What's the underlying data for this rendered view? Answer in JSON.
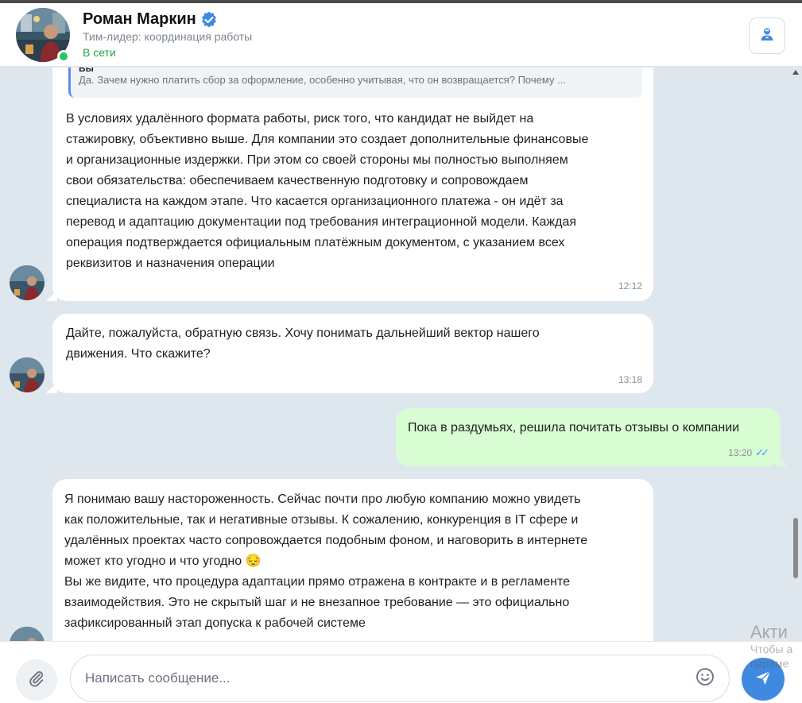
{
  "header": {
    "name": "Роман Маркин",
    "role": "Тим-лидер: координация работы",
    "status": "В сети"
  },
  "quote": {
    "author": "Вы",
    "text": "Да. Зачем нужно платить сбор за оформление, особенно учитывая, что он возвращается? Почему ..."
  },
  "messages": [
    {
      "direction": "in",
      "lines": [
        "В условиях удалённого формата работы, риск того, что кандидат не выйдет на",
        "стажировку, объективно выше. Для компании это создает дополнительные финансовые",
        "и организационные издержки. При этом со своей стороны мы полностью выполняем",
        "свои обязательства: обеспечиваем качественную подготовку и сопровождаем",
        "специалиста на каждом этапе. Что касается организационного платежа - он идёт за",
        "перевод и адаптацию документации под требования интеграционной модели. Каждая",
        "операция подтверждается официальным платёжным документом, с указанием всех",
        "реквизитов и назначения операции"
      ],
      "time": "12:12"
    },
    {
      "direction": "in",
      "lines": [
        "Дайте, пожалуйста, обратную связь. Хочу понимать дальнейший вектор нашего",
        "движения. Что скажите?"
      ],
      "time": "13:18"
    },
    {
      "direction": "out",
      "lines": [
        "Пока в раздумьях, решила почитать отзывы о компании"
      ],
      "time": "13:20",
      "read": true
    },
    {
      "direction": "in",
      "lines": [
        "Я понимаю вашу настороженность. Сейчас почти про любую компанию можно увидеть",
        "как положительные, так и негативные отзывы. К сожалению, конкуренция в IT сфере и",
        "удалённых проектах часто сопровождается подобным фоном, и наговорить в интернете",
        "может кто угодно и что угодно",
        "Вы же видите, что процедура адаптации прямо отражена в контракте и в регламенте",
        "взаимодействия. Это не скрытый шаг и не внезапное требование — это официально",
        "зафиксированный этап допуска к рабочей системе"
      ],
      "emoji": "😔"
    }
  ],
  "input": {
    "placeholder": "Написать сообщение..."
  },
  "watermark": {
    "line1": "Акти",
    "line2": "Чтобы а",
    "line3": "параме"
  },
  "icons": {
    "verified": "verified-badge-icon",
    "profile": "user-card-icon",
    "attach": "paperclip-icon",
    "emoji": "smile-icon",
    "send": "send-plane-icon",
    "read": "double-check-icon"
  },
  "colors": {
    "accent": "#3f8ae0",
    "online": "#22c55e",
    "outgoing_bubble": "#d9fdd3",
    "background": "#dfe7ee"
  }
}
